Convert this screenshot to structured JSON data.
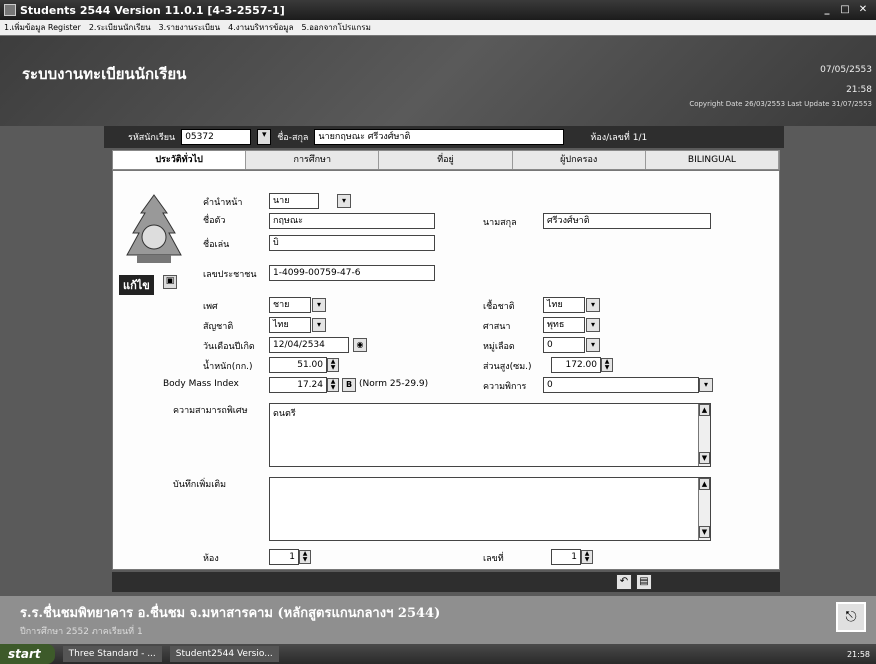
{
  "window": {
    "title": "Students 2544 Version 11.0.1 [4-3-2557-1]",
    "controls": [
      "_",
      "□",
      "✕"
    ]
  },
  "menu": [
    "1.เพิ่มข้อมูล Register",
    "2.ระเบียนนักเรียน",
    "3.รายงานระเบียน",
    "4.งานบริหารข้อมูล",
    "5.ออกจากโปรแกรม"
  ],
  "header": {
    "heading": "ระบบงานทะเบียนนักเรียน",
    "date": "07/05/2553",
    "time": "21:58",
    "copyright": "Copyright Date 26/03/2553 Last Update 31/07/2553"
  },
  "student_bar": {
    "id_label": "รหัสนักเรียน",
    "id_value": "05372",
    "name_label": "ชื่อ-สกุล",
    "name_value": "นายกฤษณะ ศรีวงศ์ษาติ",
    "class_label": "ห้อง/เลขที่ 1/1"
  },
  "tabs": [
    "ประวัติทั่วไป",
    "การศึกษา",
    "ที่อยู่",
    "ผู้ปกครอง",
    "BILINGUAL"
  ],
  "active_tab": "ประวัติทั่วไป",
  "form": {
    "prefix_label": "คำนำหน้า",
    "prefix_value": "นาย",
    "firstname_label": "ชื่อตัว",
    "firstname_value": "กฤษณะ",
    "lastname_label": "นามสกุล",
    "lastname_value": "ศรีวงศ์ษาติ",
    "nickname_label": "ชื่อเล่น",
    "nickname_value": "บิ",
    "idcard_label": "เลขประชาชน",
    "idcard_value": "1-4099-00759-47-6",
    "sex_label": "เพศ",
    "sex_value": "ชาย",
    "nationality_label": "เชื้อชาติ",
    "nationality_value": "ไทย",
    "citizenship_label": "สัญชาติ",
    "citizenship_value": "ไทย",
    "religion_label": "ศาสนา",
    "religion_value": "พุทธ",
    "birthdate_label": "วันเดือนปีเกิด",
    "birthdate_value": "12/04/2534",
    "blood_label": "หมู่เลือด",
    "blood_value": "0",
    "weight_label": "น้ำหนัก(กก.)",
    "weight_value": "51.00",
    "height_label": "ส่วนสูง(ซม.)",
    "height_value": "172.00",
    "bmi_label": "Body Mass Index",
    "bmi_value": "17.24",
    "bmi_norm": "(Norm 25-29.9)",
    "disability_label": "ความพิการ",
    "disability_value": "0",
    "ability_label": "ความสามารถพิเศษ",
    "ability_value": "ดนตรี",
    "note_label": "บันทึกเพิ่มเติม",
    "note_value": "",
    "room_label": "ห้อง",
    "room_value": "1",
    "number_label": "เลขที่",
    "number_value": "1",
    "edit_label": "แก้ไข"
  },
  "footer": {
    "school": "ร.ร.ชื่นชมพิทยาคาร อ.ชื่นชม จ.มหาสารคาม (หลักสูตรแกนกลางฯ 2544)",
    "status": "ปีการศึกษา 2552 ภาคเรียนที่ 1"
  },
  "taskbar": {
    "start": "start",
    "items": [
      "Three Standard - ...",
      "Student2544 Versio..."
    ],
    "clock": "21:58"
  }
}
